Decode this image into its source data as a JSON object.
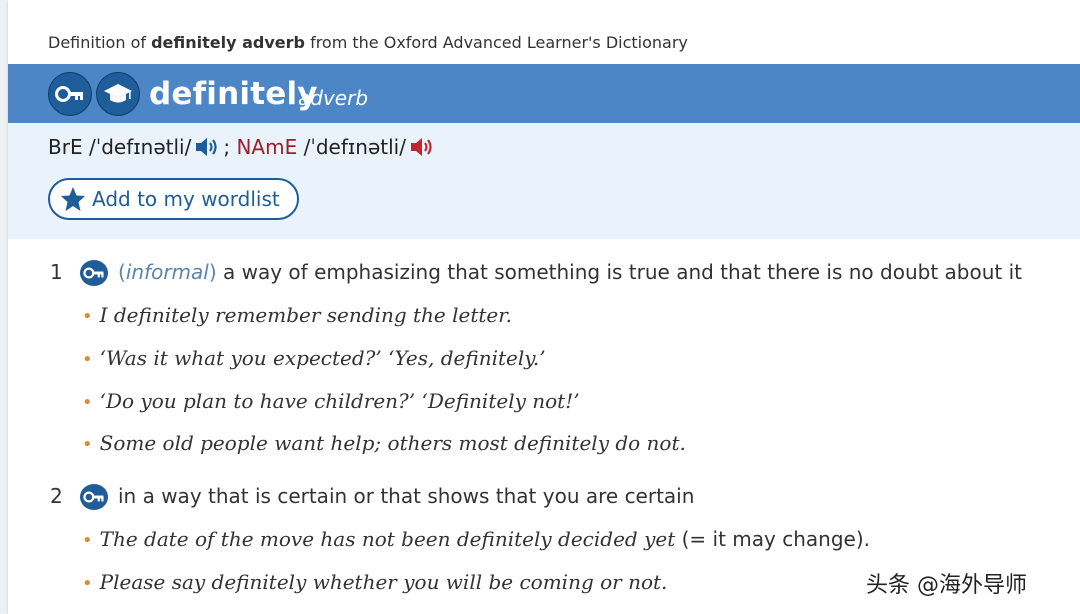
{
  "source": {
    "prefix": "Definition of ",
    "headword_label": "definitely adverb",
    "suffix": " from the Oxford Advanced Learner's Dictionary"
  },
  "header": {
    "headword": "definitely",
    "pos": "adverb",
    "icons": [
      "oxford-3000-key-icon",
      "academic-cap-icon"
    ],
    "bar_color": "#4d86c7"
  },
  "pronunciation": {
    "bre_label": "BrE",
    "bre_ipa": "/ˈdefɪnətli/",
    "separator": ";",
    "name_label": "NAmE",
    "name_ipa": "/ˈdefɪnətli/",
    "bre_audio_color": "#1f5c9a",
    "name_audio_color": "#c0282e"
  },
  "wordlist_button": {
    "label": "Add to my wordlist",
    "icon": "star-icon"
  },
  "senses": [
    {
      "number": "1",
      "register": "informal",
      "definition": " a way of emphasizing that something is true and that there is no doubt about it",
      "examples": [
        "I definitely remember sending the letter.",
        "‘Was it what you expected?’ ‘Yes, definitely.’",
        "‘Do you plan to have children?’ ‘Definitely not!’",
        "Some old people want help; others most definitely do not."
      ]
    },
    {
      "number": "2",
      "definition": "in a way that is certain or that shows that you are certain",
      "examples": [
        {
          "text": "The date of the move has not been definitely decided yet",
          "gloss": " (= it may change)."
        },
        "Please say definitely whether you will be coming or not."
      ]
    }
  ],
  "watermark": "头条 @海外导师"
}
